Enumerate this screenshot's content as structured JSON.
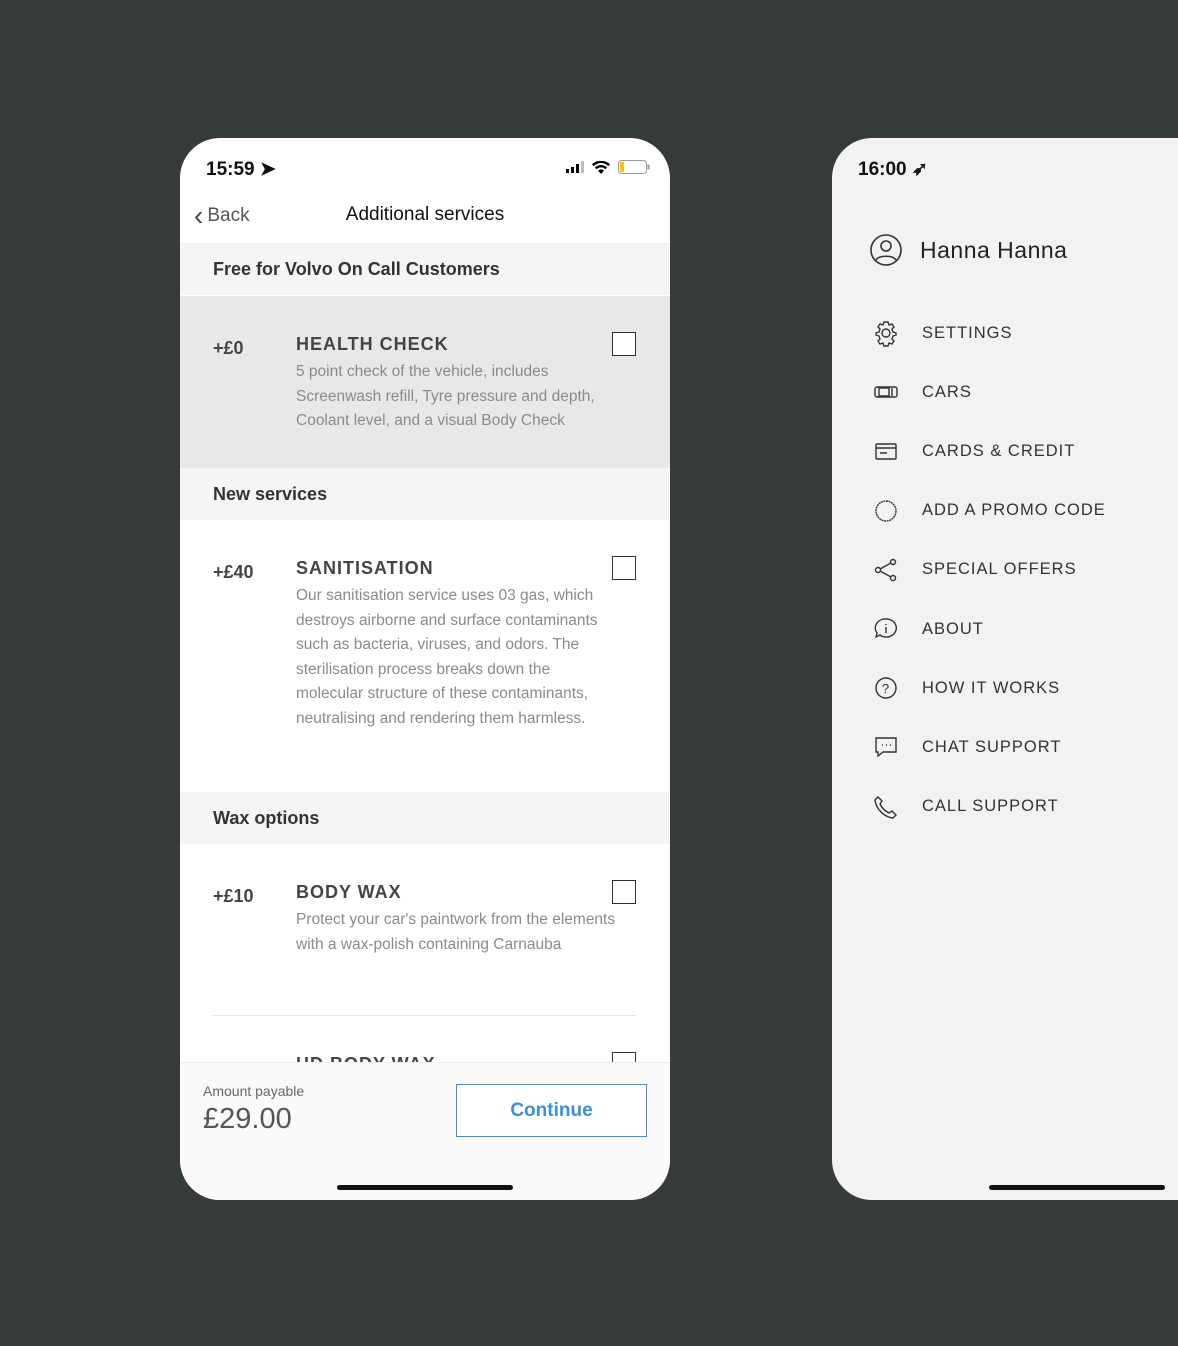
{
  "left": {
    "time": "15:59",
    "back": "Back",
    "title": "Additional services",
    "sections": [
      {
        "title": "Free for Volvo On Call Customers"
      },
      {
        "title": "New services"
      },
      {
        "title": "Wax options"
      }
    ],
    "items": [
      {
        "price": "+£0",
        "name": "HEALTH CHECK",
        "desc": "5 point check of the vehicle, includes Screenwash refill, Tyre pressure and depth, Coolant level, and a visual Body Check",
        "checked": false
      },
      {
        "price": "+£40",
        "name": "SANITISATION",
        "desc": "Our sanitisation service uses 03 gas, which destroys airborne and surface contaminants such as bacteria, viruses, and odors. The sterilisation process breaks down the molecular structure of these contaminants, neutralising and rendering them harmless.",
        "checked": false
      },
      {
        "price": "+£10",
        "name": "BODY WAX",
        "desc": "Protect your car's paintwork from the elements with a wax-polish containing Carnauba",
        "checked": false
      },
      {
        "name": "HD BODY WAX",
        "checked": false
      }
    ],
    "footer": {
      "label": "Amount payable",
      "amount": "£29.00",
      "button": "Continue"
    },
    "accent": "#3a8fdc"
  },
  "right": {
    "time": "16:00",
    "user": "Hanna Hanna",
    "menu": [
      {
        "label": "SETTINGS",
        "icon": "gear-icon"
      },
      {
        "label": "CARS",
        "icon": "car-icon"
      },
      {
        "label": "CARDS & CREDIT",
        "icon": "credit-card-icon"
      },
      {
        "label": "ADD A PROMO CODE",
        "icon": "promo-badge-icon"
      },
      {
        "label": "SPECIAL OFFERS",
        "icon": "share-icon"
      },
      {
        "label": "ABOUT",
        "icon": "info-bubble-icon"
      },
      {
        "label": "HOW IT WORKS",
        "icon": "question-icon"
      },
      {
        "label": "CHAT SUPPORT",
        "icon": "chat-icon"
      },
      {
        "label": "CALL SUPPORT",
        "icon": "phone-icon"
      }
    ]
  }
}
